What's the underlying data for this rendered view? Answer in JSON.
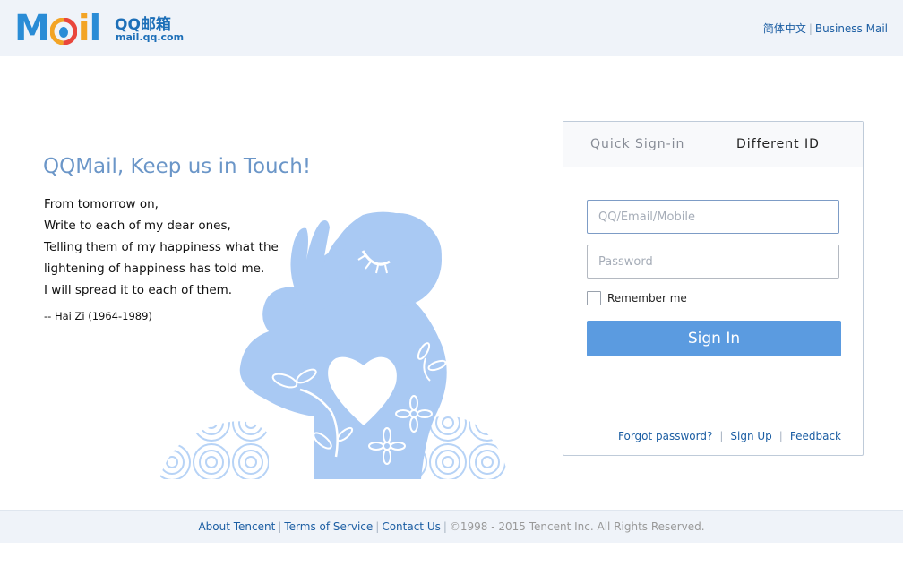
{
  "header": {
    "logo_mail": "Mail",
    "logo_cn": "QQ邮箱",
    "logo_url": "mail.qq.com",
    "lang_cn": "简体中文",
    "lang_sep": "|",
    "business": "Business Mail"
  },
  "promo": {
    "title": "QQMail, Keep us in Touch!",
    "poem": [
      "From tomorrow on,",
      "Write to each of my dear ones,",
      "Telling them of my happiness what the",
      "lightening of happiness has told me.",
      "I will spread it to each of them."
    ],
    "author": "-- Hai Zi (1964-1989)"
  },
  "login": {
    "tabs": [
      "Quick  Sign-in",
      "Different  ID"
    ],
    "username_placeholder": "QQ/Email/Mobile",
    "password_placeholder": "Password",
    "remember_label": "Remember me",
    "signin_label": "Sign In",
    "links": {
      "forgot": "Forgot password?",
      "signup": "Sign Up",
      "feedback": "Feedback"
    },
    "sep": "|"
  },
  "footer": {
    "about": "About Tencent",
    "terms": "Terms of Service",
    "contact": "Contact Us",
    "copyright": "©1998 - 2015 Tencent Inc. All Rights Reserved.",
    "sep": "|"
  },
  "colors": {
    "accent": "#5b9be0",
    "link": "#1c5ea3",
    "header_bg": "#eff3f9",
    "title": "#6b96c8",
    "illustration": "#a9c9f3"
  }
}
